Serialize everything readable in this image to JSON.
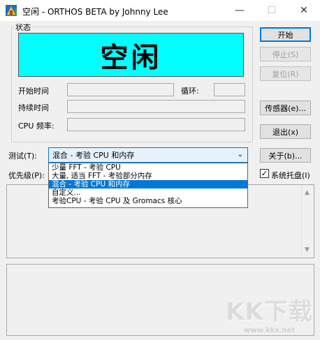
{
  "window": {
    "title": "空闲 - ORTHOS BETA by Johnny Lee",
    "minimize_glyph": "—",
    "maximize_glyph": "☐",
    "close_glyph": "✕"
  },
  "status_group": {
    "legend": "状态",
    "status_text": "空闲",
    "status_color": "#00ffff",
    "start_time_label": "开始时间",
    "start_time_value": "",
    "loop_label": "循环:",
    "loop_value": "",
    "duration_label": "持续时间",
    "duration_value": "",
    "cpu_freq_label": "CPU 频率:",
    "cpu_freq_value": ""
  },
  "buttons": {
    "start": "开始",
    "stop": "停止(S)",
    "reset": "复位(R)",
    "sensor": "传感器(e)...",
    "exit": "退出(x)",
    "about": "关于(b)..."
  },
  "test": {
    "label": "测试(T):",
    "selected": "混合 - 考验 CPU 和内存",
    "options": [
      "少量 FFT - 考验 CPU",
      "大量, 适当 FFT - 考验部分内存",
      "混合 - 考验 CPU 和内存",
      "自定义...",
      "考验CPU - 考验 CPU 及 Gromacs 核心"
    ],
    "highlighted_index": 2
  },
  "priority": {
    "label": "优先级(P):"
  },
  "tray": {
    "label": "系统托盘(I)",
    "checked": true,
    "check_glyph": "✓"
  },
  "watermark": {
    "text": "KK下载",
    "url": "www.kkx.net"
  },
  "colors": {
    "accent": "#0078d7"
  }
}
